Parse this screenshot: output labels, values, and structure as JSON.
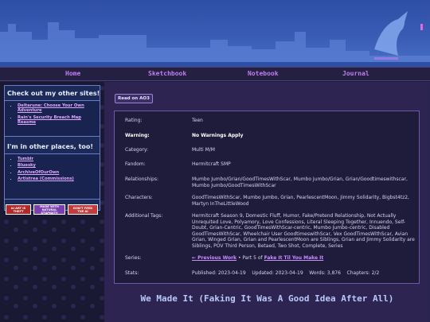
{
  "nav": {
    "items": [
      "Home",
      "Sketchbook",
      "Notebook",
      "Journal"
    ]
  },
  "sidebar": {
    "sites_title": "Check out my other sites!",
    "sites": [
      "Deltarune: Choose Your Own Adventure",
      "Rain's Security Breach Map Reasme"
    ],
    "places_title": "I'm in other places, too!",
    "places": [
      "Tumblr",
      "Bluesky",
      "ArchiveOfOurOwn",
      "Artistrea (Commissions)"
    ],
    "badges": [
      "AI ART IS THEFT",
      "MADE WITH NATURAL STUPIDITY",
      "DON'T FEED THE AI"
    ]
  },
  "main": {
    "read_button": "Read on AO3",
    "meta": {
      "rating_label": "Rating:",
      "rating": "Teen",
      "warning_label": "Warning:",
      "warning": "No Warnings Apply",
      "category_label": "Category:",
      "category": "Multi M/M",
      "fandom_label": "Fandom:",
      "fandom": "Hermitcraft SMP",
      "relationships_label": "Relationships:",
      "relationships": "Mumbo Jumbo/Grian/GoodTimesWithScar, Mumbo Jumbo/Grian, Grian/Goodtimeswithscar, Mumbo Jumbo/GoodTimesWithScar",
      "characters_label": "Characters:",
      "characters": "GoodTimesWithScar, Mumbo Jumbo, Grian, PearlescentMoon, Jimmy Solidarity, Bigbst4tz2, Martyn InTheLittleWood",
      "tags_label": "Additional Tags:",
      "tags": "Hermitcraft Season 9, Domestic Fluff, Humor, Fake/Pretend Relationship, Not Actually Unrequited Love, Polyamory, Love Confessions, Literal Sleeping Together, Innuendo, Self-Doubt, Grian-Centric, GoodTimesWithScar-centric, Mumbo Jumbo-centric, Disabled GoodTimesWithScar, Wheelchair User GoodtimeswithScar, Vex GoodTimesWithScar, Avian Grian, Winged Grian, Grian and PearlescentMoon are Siblings, Grian and Jimmy Solidarity are Siblings, POV Third Person, Betaed, Two Shot, Complete, Series",
      "series_label": "Series:",
      "series_prev": "← Previous Work",
      "series_text": " • Part 5 of ",
      "series_name": "Fake It Til You Make It",
      "stats_label": "Stats:",
      "stats": "Published: 2023-04-19    Updated: 2023-04-19    Words: 3,876    Chapters: 2/2"
    },
    "work_title": "We Made It (Faking It Was A Good Idea After All)"
  },
  "colors": {
    "accent": "#c57cf0",
    "header_blue": "#3a5cb5",
    "panel": "#1f1b3b"
  }
}
